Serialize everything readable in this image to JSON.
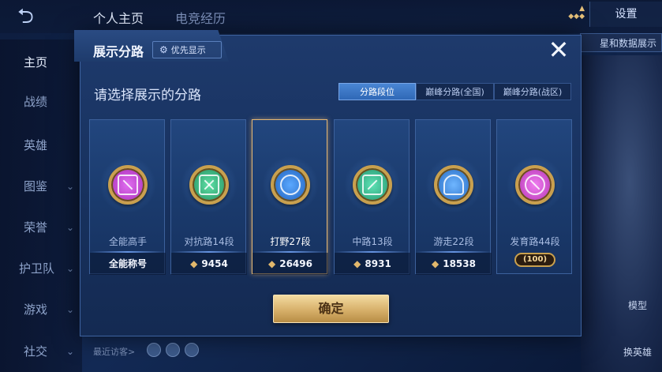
{
  "background": {
    "tabs": [
      "个人主页",
      "电竞经历"
    ],
    "settings_label": "设置",
    "side_label": "星和数据展示",
    "sidebar": [
      {
        "label": "主页",
        "active": true,
        "chevron": false
      },
      {
        "label": "战绩",
        "active": false,
        "chevron": false
      },
      {
        "label": "英雄",
        "active": false,
        "chevron": false
      },
      {
        "label": "图鉴",
        "active": false,
        "chevron": true
      },
      {
        "label": "荣誉",
        "active": false,
        "chevron": true
      },
      {
        "label": "护卫队",
        "active": false,
        "chevron": true
      },
      {
        "label": "游戏",
        "active": false,
        "chevron": true
      },
      {
        "label": "社交",
        "active": false,
        "chevron": true
      }
    ],
    "visitors_label": "最近访客>",
    "model_label": "模型",
    "hero_label": "换英雄"
  },
  "modal": {
    "title": "展示分路",
    "priority_label": "优先显示",
    "subtitle": "请选择展示的分路",
    "segments": [
      {
        "label": "分路段位",
        "active": true
      },
      {
        "label": "巅峰分路(全国)",
        "active": false
      },
      {
        "label": "巅峰分路(战区)",
        "active": false
      }
    ],
    "confirm_label": "确定",
    "lanes": [
      {
        "label": "全能高手",
        "footer": "全能称号",
        "footer_type": "text",
        "color": "#c43fd1",
        "selected": false
      },
      {
        "label": "对抗路14段",
        "footer": "9454",
        "footer_type": "score",
        "color": "#34b07a",
        "selected": false
      },
      {
        "label": "打野27段",
        "footer": "26496",
        "footer_type": "score",
        "color": "#2f7fd6",
        "selected": true
      },
      {
        "label": "中路13段",
        "footer": "8931",
        "footer_type": "score",
        "color": "#2fb08a",
        "selected": false
      },
      {
        "label": "游走22段",
        "footer": "18538",
        "footer_type": "score",
        "color": "#2f7fd6",
        "selected": false
      },
      {
        "label": "发育路44段",
        "footer": "100",
        "footer_type": "stars",
        "color": "#d04fc8",
        "selected": false
      }
    ]
  },
  "colors": {
    "accent_gold": "#d7b06a",
    "segment_active": "#3f7bcb",
    "modal_bg": "#1b3564"
  }
}
